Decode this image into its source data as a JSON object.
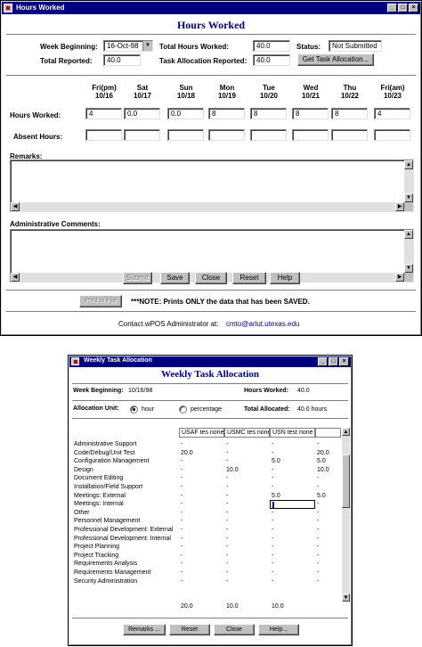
{
  "hours_window": {
    "title": "Hours Worked",
    "heading": "Hours Worked",
    "week_beginning_label": "Week Beginning:",
    "week_beginning_value": "16-Oct-98",
    "total_hours_label": "Total Hours Worked:",
    "total_hours_value": "40.0",
    "status_label": "Status:",
    "status_value": "Not Submitted",
    "total_reported_label": "Total Reported:",
    "total_reported_value": "40.0",
    "task_alloc_reported_label": "Task Allocation Reported:",
    "task_alloc_reported_value": "40.0",
    "get_task_allocation_label": "Get Task Allocation...",
    "days": [
      {
        "day": "Fri(pm)",
        "date": "10/16",
        "hours": "4",
        "absent": ""
      },
      {
        "day": "Sat",
        "date": "10/17",
        "hours": "0.0",
        "absent": ""
      },
      {
        "day": "Sun",
        "date": "10/18",
        "hours": "0.0",
        "absent": ""
      },
      {
        "day": "Mon",
        "date": "10/19",
        "hours": "8",
        "absent": ""
      },
      {
        "day": "Tue",
        "date": "10/20",
        "hours": "8",
        "absent": ""
      },
      {
        "day": "Wed",
        "date": "10/21",
        "hours": "8",
        "absent": ""
      },
      {
        "day": "Thu",
        "date": "10/22",
        "hours": "8",
        "absent": ""
      },
      {
        "day": "Fri(am)",
        "date": "10/23",
        "hours": "4",
        "absent": ""
      }
    ],
    "hours_worked_label": "Hours Worked:",
    "absent_hours_label": "Absent Hours:",
    "remarks_label": "Remarks:",
    "admin_comments_label": "Administrative Comments:",
    "buttons": {
      "submit": "Submit",
      "save": "Save",
      "close": "Close",
      "reset": "Reset",
      "help": "Help"
    },
    "print_label": "Print to File",
    "note": "***NOTE: Prints ONLY the data that has been SAVED.",
    "contact_label": "Contact wPOS Administrator at:",
    "contact_email": "cmto@arlut.utexas.edu"
  },
  "allocation_window": {
    "title": "Weekly Task Allocation",
    "heading": "Weekly Task Allocation",
    "week_beginning_label": "Week Beginning:",
    "week_beginning_value": "10/16/98",
    "hours_worked_label": "Hours Worked:",
    "hours_worked_value": "40.0",
    "allocation_unit_label": "Allocation Unit:",
    "unit_hour": "hour",
    "unit_percentage": "percentage",
    "total_allocated_label": "Total Allocated:",
    "total_allocated_value": "40.0 hours",
    "columns": [
      "USAF tes none",
      "USMC tes none",
      "USN test none"
    ],
    "tasks": [
      {
        "name": "Administrative Support",
        "values": [
          "-",
          "-",
          "-",
          "-"
        ]
      },
      {
        "name": "Code/Debug/Unit Test",
        "values": [
          "20.0",
          "-",
          "-",
          "20.0"
        ]
      },
      {
        "name": "Configuration Management",
        "values": [
          "-",
          "-",
          "5.0",
          "5.0"
        ]
      },
      {
        "name": "Design",
        "values": [
          "-",
          "10.0",
          "-",
          "10.0"
        ]
      },
      {
        "name": "Document Editing",
        "values": [
          "-",
          "-",
          "-",
          "-"
        ]
      },
      {
        "name": "Installation/Field Support",
        "values": [
          "-",
          "-",
          "-",
          "-"
        ]
      },
      {
        "name": "Meetings: External",
        "values": [
          "-",
          "-",
          "5.0",
          "5.0"
        ]
      },
      {
        "name": "Meetings: Internal",
        "values": [
          "-",
          "-",
          "",
          "-"
        ]
      },
      {
        "name": "Other",
        "values": [
          "-",
          "-",
          "-",
          "-"
        ]
      },
      {
        "name": "Personnel Management",
        "values": [
          "-",
          "-",
          "-",
          "-"
        ]
      },
      {
        "name": "Professional Development: External",
        "values": [
          "-",
          "-",
          "-",
          "-"
        ]
      },
      {
        "name": "Professional Development: Internal",
        "values": [
          "-",
          "-",
          "-",
          "-"
        ]
      },
      {
        "name": "Project Planning",
        "values": [
          "-",
          "-",
          "-",
          "-"
        ]
      },
      {
        "name": "Project Tracking",
        "values": [
          "-",
          "-",
          "-",
          "-"
        ]
      },
      {
        "name": "Requirements Analysis",
        "values": [
          "-",
          "-",
          "-",
          "-"
        ]
      },
      {
        "name": "Requirements Management",
        "values": [
          "-",
          "-",
          "-",
          "-"
        ]
      },
      {
        "name": "Security Administration",
        "values": [
          "-",
          "-",
          "-",
          "-"
        ]
      }
    ],
    "totals": [
      "20.0",
      "10.0",
      "10.0"
    ],
    "buttons": {
      "remarks": "Remarks ...",
      "reset": "Reset",
      "close": "Close",
      "help": "Help..."
    }
  }
}
